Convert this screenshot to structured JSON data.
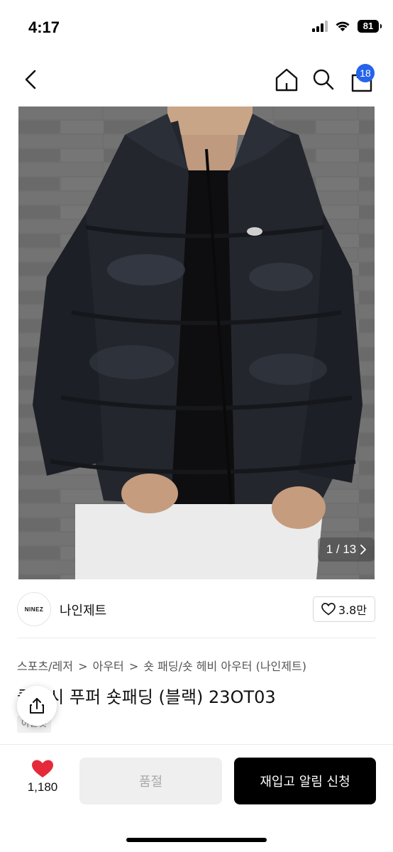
{
  "status_bar": {
    "time": "4:17",
    "battery": "81",
    "icons": [
      "signal-icon",
      "wifi-icon",
      "battery-icon"
    ]
  },
  "nav": {
    "icons": [
      "back-icon",
      "home-icon",
      "search-icon",
      "cart-icon"
    ],
    "cart_badge": "18",
    "accent_color": "#2563eb"
  },
  "gallery": {
    "counter_current": "1 / 13",
    "next_icon": "chevron-right-icon"
  },
  "brand": {
    "logo_text": "NINEZ",
    "name": "나인제트",
    "likes": "3.8만",
    "heart_icon": "heart-outline-icon"
  },
  "product": {
    "breadcrumb": [
      "스포츠/레저",
      "아우터",
      "숏 패딩/숏 헤비 아우터 (나인제트)"
    ],
    "title": "클래시 푸퍼 숏패딩 (블랙) 23OT03",
    "tag": "아울렛"
  },
  "bottom_bar": {
    "wish_count": "1,180",
    "wish_color": "#e5293b",
    "soldout_label": "품절",
    "restock_label": "재입고 알림 신청"
  }
}
